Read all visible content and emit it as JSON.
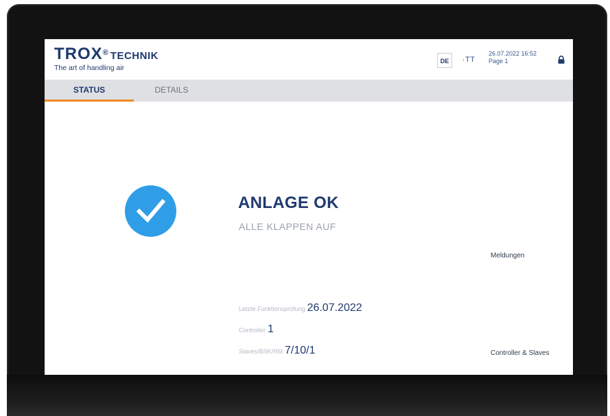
{
  "header": {
    "brand": "TROX",
    "brand_reg": "®",
    "brand_sub": "TECHNIK",
    "tagline": "The art of handling air",
    "language": "DE",
    "font_size_control": "TT",
    "date_time": "26.07.2022 16:52",
    "page": "Page 1"
  },
  "tabs": [
    {
      "label": "STATUS",
      "active": true
    },
    {
      "label": "DETAILS",
      "active": false
    }
  ],
  "status": {
    "title": "ANLAGE OK",
    "subtitle": "ALLE KLAPPEN AUF"
  },
  "links": {
    "messages": "Meldungen",
    "controllers": "Controller & Slaves"
  },
  "info": {
    "last_test_label": "Letzte Funktionsprüfung",
    "last_test_value": "26.07.2022",
    "controller_label": "Controller",
    "controller_value": "1",
    "slaves_label": "Slaves/BSK/RM",
    "slaves_value": "7/10/1"
  },
  "colors": {
    "brand_blue": "#1f3a6e",
    "accent_orange": "#f08a24",
    "check_blue": "#2f9ee6",
    "tab_bar": "#dfe0e3"
  },
  "icons": {
    "status": "check-circle-icon",
    "lock": "lock-icon"
  }
}
